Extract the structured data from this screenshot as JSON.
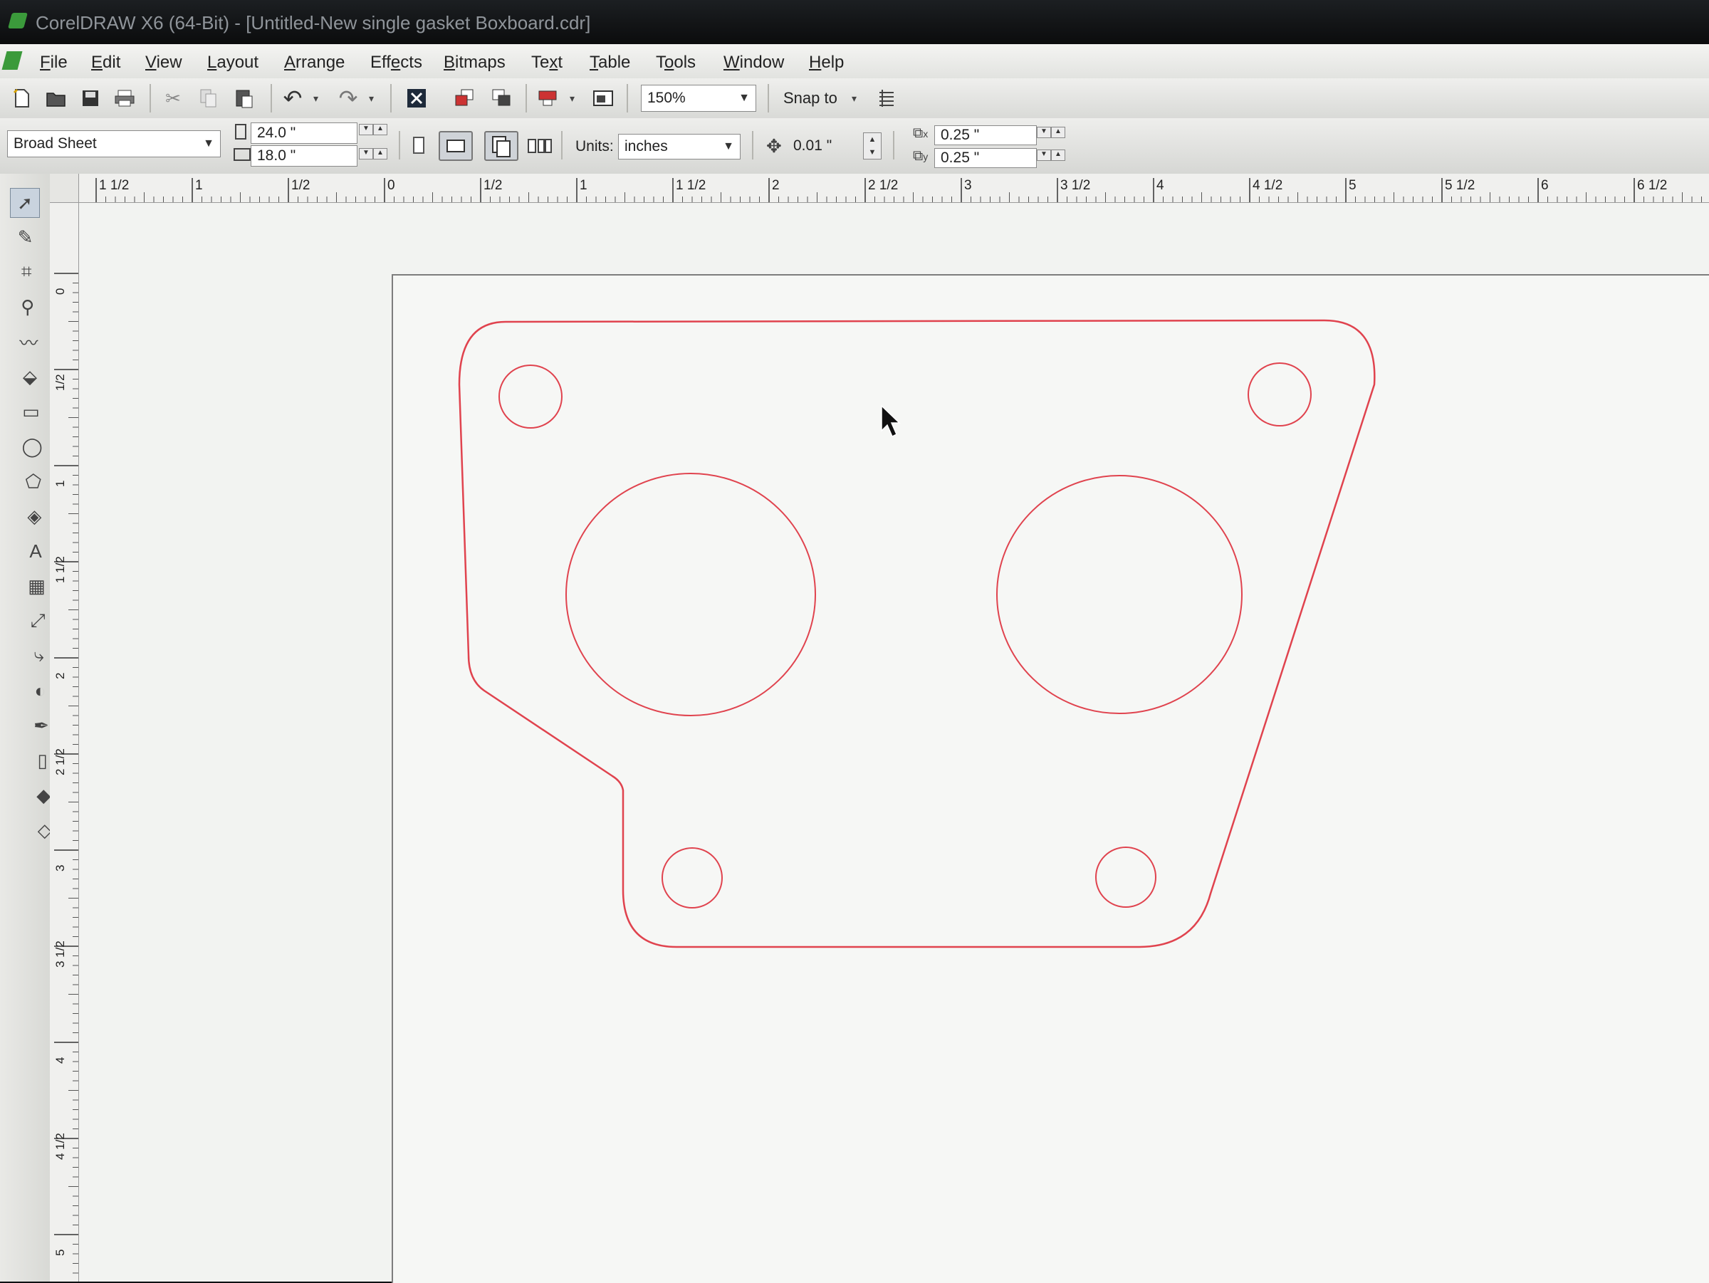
{
  "window": {
    "title": "CorelDRAW X6 (64-Bit) - [Untitled-New single gasket Boxboard.cdr]"
  },
  "menu": {
    "items": [
      {
        "pre": "",
        "u": "F",
        "post": "ile"
      },
      {
        "pre": "",
        "u": "E",
        "post": "dit"
      },
      {
        "pre": "",
        "u": "V",
        "post": "iew"
      },
      {
        "pre": "",
        "u": "L",
        "post": "ayout"
      },
      {
        "pre": "",
        "u": "A",
        "post": "rrange"
      },
      {
        "pre": "Eff",
        "u": "e",
        "post": "cts"
      },
      {
        "pre": "",
        "u": "B",
        "post": "itmaps"
      },
      {
        "pre": "Te",
        "u": "x",
        "post": "t"
      },
      {
        "pre": "",
        "u": "T",
        "post": "able"
      },
      {
        "pre": "T",
        "u": "o",
        "post": "ols"
      },
      {
        "pre": "",
        "u": "W",
        "post": "indow"
      },
      {
        "pre": "",
        "u": "H",
        "post": "elp"
      }
    ]
  },
  "toolbar": {
    "zoom": "150%",
    "snap_to": "Snap to"
  },
  "property_bar": {
    "page_preset": "Broad Sheet",
    "width": "24.0 \"",
    "height": "18.0 \"",
    "units_label": "Units:",
    "units_value": "inches",
    "nudge": "0.01 \"",
    "dup_x": "0.25 \"",
    "dup_y": "0.25 \""
  },
  "ruler_h": {
    "labels": [
      "1 1/2",
      "1",
      "1/2",
      "0",
      "1/2",
      "1",
      "1 1/2",
      "2",
      "2 1/2",
      "3",
      "3 1/2",
      "4",
      "4 1/2",
      "5",
      "5 1/2",
      "6",
      "6 1/2"
    ]
  },
  "ruler_v": {
    "labels": [
      "0",
      "1/2",
      "1",
      "1 1/2",
      "2",
      "2 1/2",
      "3",
      "3 1/2",
      "4",
      "4 1/2",
      "5"
    ]
  },
  "icons": {
    "toolbar": [
      "new-icon",
      "open-icon",
      "save-icon",
      "print-icon",
      "cut-icon",
      "copy-icon",
      "paste-icon",
      "undo-icon",
      "redo-icon",
      "search-content-icon",
      "import-icon",
      "export-icon",
      "publish-pdf-icon",
      "app-launcher-icon",
      "snap-options-icon"
    ],
    "toolbox": [
      "pick-tool-icon",
      "shape-tool-icon",
      "crop-tool-icon",
      "zoom-tool-icon",
      "freehand-tool-icon",
      "smart-fill-icon",
      "rectangle-tool-icon",
      "ellipse-tool-icon",
      "polygon-tool-icon",
      "basic-shapes-icon",
      "text-tool-icon",
      "table-tool-icon",
      "dimension-tool-icon",
      "connector-tool-icon",
      "blend-tool-icon",
      "eyedropper-tool-icon",
      "outline-tool-icon",
      "fill-tool-icon",
      "interactive-fill-icon"
    ]
  },
  "drawing": {
    "outline_color": "#e0434e"
  }
}
